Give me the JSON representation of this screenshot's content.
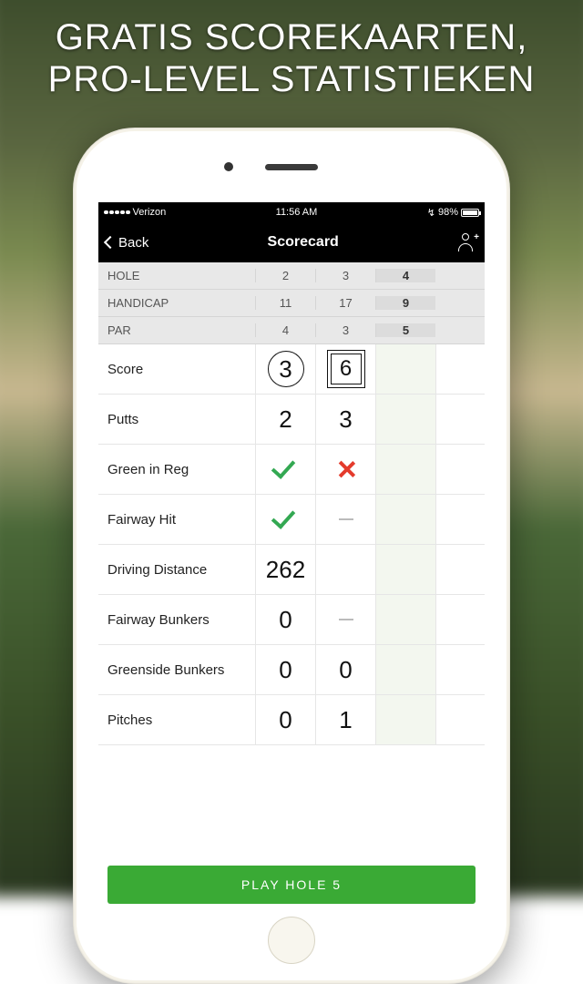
{
  "promo": {
    "line1": "GRATIS SCOREKAARTEN,",
    "line2": "PRO-LEVEL STATISTIEKEN"
  },
  "statusbar": {
    "carrier": "Verizon",
    "time": "11:56 AM",
    "battery_pct": "98%",
    "charging_glyph": "↯"
  },
  "navbar": {
    "back_label": "Back",
    "title": "Scorecard"
  },
  "header": {
    "rows": [
      {
        "label": "HOLE",
        "cells": [
          "2",
          "3",
          "4"
        ]
      },
      {
        "label": "HANDICAP",
        "cells": [
          "11",
          "17",
          "9"
        ]
      },
      {
        "label": "PAR",
        "cells": [
          "4",
          "3",
          "5"
        ]
      }
    ]
  },
  "rows": [
    {
      "label": "Score",
      "cells": [
        {
          "kind": "circle",
          "value": "3"
        },
        {
          "kind": "dsquare",
          "value": "6"
        },
        {
          "kind": "empty"
        }
      ]
    },
    {
      "label": "Putts",
      "cells": [
        {
          "kind": "num",
          "value": "2"
        },
        {
          "kind": "num",
          "value": "3"
        },
        {
          "kind": "empty"
        }
      ]
    },
    {
      "label": "Green in Reg",
      "cells": [
        {
          "kind": "check"
        },
        {
          "kind": "cross"
        },
        {
          "kind": "empty"
        }
      ]
    },
    {
      "label": "Fairway Hit",
      "cells": [
        {
          "kind": "check"
        },
        {
          "kind": "dash"
        },
        {
          "kind": "empty"
        }
      ]
    },
    {
      "label": "Driving Distance",
      "cells": [
        {
          "kind": "num",
          "value": "262"
        },
        {
          "kind": "empty"
        },
        {
          "kind": "empty"
        }
      ]
    },
    {
      "label": "Fairway Bunkers",
      "cells": [
        {
          "kind": "num",
          "value": "0"
        },
        {
          "kind": "dash"
        },
        {
          "kind": "empty"
        }
      ]
    },
    {
      "label": "Greenside Bunkers",
      "cells": [
        {
          "kind": "num",
          "value": "0"
        },
        {
          "kind": "num",
          "value": "0"
        },
        {
          "kind": "empty"
        }
      ]
    },
    {
      "label": "Pitches",
      "cells": [
        {
          "kind": "num",
          "value": "0"
        },
        {
          "kind": "num",
          "value": "1"
        },
        {
          "kind": "empty"
        }
      ]
    }
  ],
  "cta": {
    "label": "PLAY HOLE 5"
  }
}
